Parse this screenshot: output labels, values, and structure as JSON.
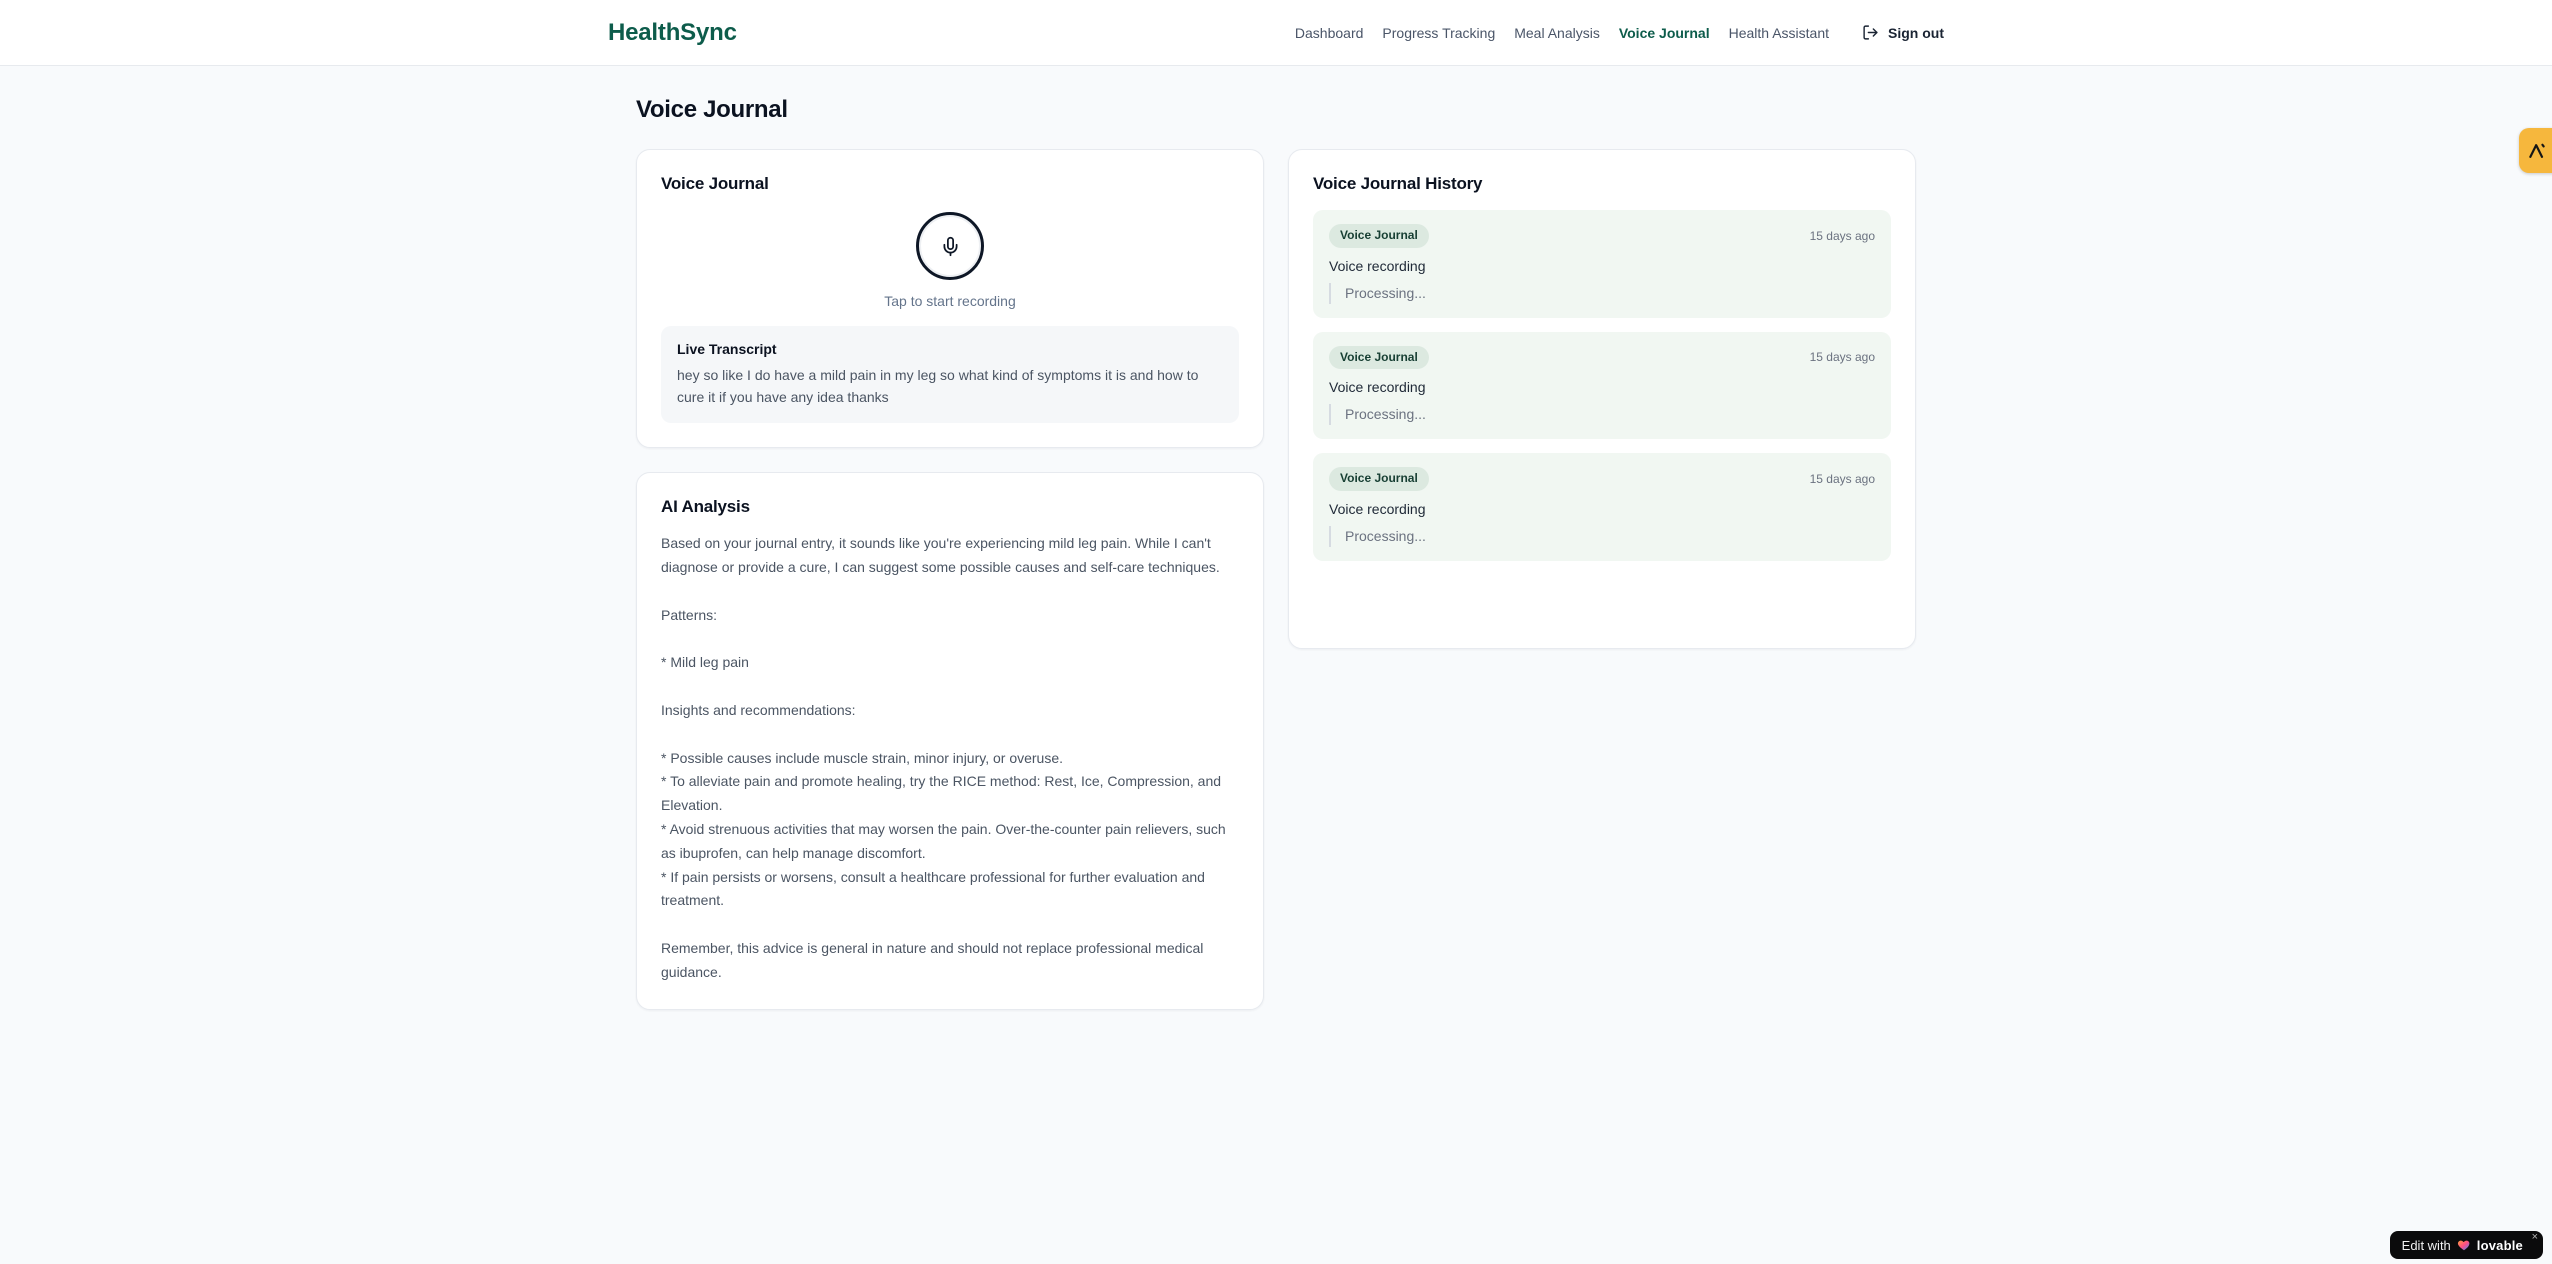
{
  "colors": {
    "brand_green": "#0d5c4b",
    "page_bg": "#f8fafc",
    "history_item_bg": "#f1f7f2",
    "badge_bg": "#dce9e0",
    "badge_text": "#173f33",
    "side_tab_amber": "#f6b73d",
    "lovable_pill_bg": "#0b0b0c"
  },
  "header": {
    "brand": "HealthSync",
    "nav": {
      "items": [
        {
          "label": "Dashboard",
          "active": false
        },
        {
          "label": "Progress Tracking",
          "active": false
        },
        {
          "label": "Meal Analysis",
          "active": false
        },
        {
          "label": "Voice Journal",
          "active": true
        },
        {
          "label": "Health Assistant",
          "active": false
        }
      ],
      "signout_label": "Sign out",
      "signout_icon": "log-out-icon"
    }
  },
  "page": {
    "title": "Voice Journal"
  },
  "recorder": {
    "card_title": "Voice Journal",
    "mic_icon": "microphone-icon",
    "tap_hint": "Tap to start recording",
    "transcript_title": "Live Transcript",
    "transcript_text": "hey so like I do have a mild pain in my leg so what kind of symptoms it is and how to cure it if you have any idea thanks"
  },
  "analysis": {
    "card_title": "AI Analysis",
    "body": "Based on your journal entry, it sounds like you're experiencing mild leg pain. While I can't diagnose or provide a cure, I can suggest some possible causes and self-care techniques.\n\nPatterns:\n\n* Mild leg pain\n\nInsights and recommendations:\n\n* Possible causes include muscle strain, minor injury, or overuse.\n* To alleviate pain and promote healing, try the RICE method: Rest, Ice, Compression, and Elevation.\n* Avoid strenuous activities that may worsen the pain. Over-the-counter pain relievers, such as ibuprofen, can help manage discomfort.\n* If pain persists or worsens, consult a healthcare professional for further evaluation and treatment.\n\nRemember, this advice is general in nature and should not replace professional medical guidance."
  },
  "history": {
    "card_title": "Voice Journal History",
    "entries": [
      {
        "badge": "Voice Journal",
        "time": "15 days ago",
        "label": "Voice recording",
        "status": "Processing..."
      },
      {
        "badge": "Voice Journal",
        "time": "15 days ago",
        "label": "Voice recording",
        "status": "Processing..."
      },
      {
        "badge": "Voice Journal",
        "time": "15 days ago",
        "label": "Voice recording",
        "status": "Processing..."
      }
    ]
  },
  "lovable": {
    "edit_with": "Edit with",
    "brand": "lovable",
    "close": "×",
    "heart_icon": "lovable-heart-icon",
    "side_tab_icon": "lovable-logo-icon"
  }
}
